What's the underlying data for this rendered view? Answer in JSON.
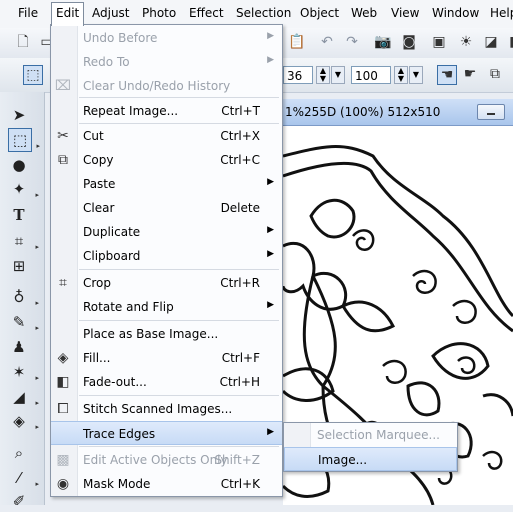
{
  "menubar": [
    "File",
    "Edit",
    "Adjust",
    "Photo",
    "Effect",
    "Selection",
    "Object",
    "Web",
    "View",
    "Window",
    "Help"
  ],
  "toolbar": {
    "field_a": "36",
    "field_b": "100"
  },
  "document": {
    "title": "1%255D (100%) 512x510"
  },
  "edit_menu": [
    {
      "label": "Undo Before",
      "shortcut": "",
      "submenu": true,
      "disabled": true,
      "icon": ""
    },
    {
      "label": "Redo To",
      "shortcut": "",
      "submenu": true,
      "disabled": true,
      "icon": ""
    },
    {
      "label": "Clear Undo/Redo History",
      "shortcut": "",
      "submenu": false,
      "disabled": true,
      "icon": "clear-history-icon"
    },
    {
      "label": "Repeat Image...",
      "shortcut": "Ctrl+T",
      "submenu": false,
      "disabled": false,
      "icon": ""
    },
    {
      "label": "Cut",
      "shortcut": "Ctrl+X",
      "submenu": false,
      "disabled": false,
      "icon": "scissors-icon"
    },
    {
      "label": "Copy",
      "shortcut": "Ctrl+C",
      "submenu": false,
      "disabled": false,
      "icon": "copy-icon"
    },
    {
      "label": "Paste",
      "shortcut": "",
      "submenu": true,
      "disabled": false,
      "icon": ""
    },
    {
      "label": "Clear",
      "shortcut": "Delete",
      "submenu": false,
      "disabled": false,
      "icon": ""
    },
    {
      "label": "Duplicate",
      "shortcut": "",
      "submenu": true,
      "disabled": false,
      "icon": ""
    },
    {
      "label": "Clipboard",
      "shortcut": "",
      "submenu": true,
      "disabled": false,
      "icon": ""
    },
    {
      "label": "Crop",
      "shortcut": "Ctrl+R",
      "submenu": false,
      "disabled": false,
      "icon": "crop-icon"
    },
    {
      "label": "Rotate and Flip",
      "shortcut": "",
      "submenu": true,
      "disabled": false,
      "icon": ""
    },
    {
      "label": "Place as Base Image...",
      "shortcut": "",
      "submenu": false,
      "disabled": false,
      "icon": ""
    },
    {
      "label": "Fill...",
      "shortcut": "Ctrl+F",
      "submenu": false,
      "disabled": false,
      "icon": "fill-bucket-icon"
    },
    {
      "label": "Fade-out...",
      "shortcut": "Ctrl+H",
      "submenu": false,
      "disabled": false,
      "icon": "fade-out-icon"
    },
    {
      "label": "Stitch Scanned Images...",
      "shortcut": "",
      "submenu": false,
      "disabled": false,
      "icon": "stitch-icon"
    },
    {
      "label": "Trace Edges",
      "shortcut": "",
      "submenu": true,
      "disabled": false,
      "icon": ""
    },
    {
      "label": "Edit Active Objects Only",
      "shortcut": "Shift+Z",
      "submenu": false,
      "disabled": true,
      "icon": "active-objects-icon"
    },
    {
      "label": "Mask Mode",
      "shortcut": "Ctrl+K",
      "submenu": false,
      "disabled": false,
      "icon": "mask-mode-icon"
    }
  ],
  "trace_edges_submenu": [
    {
      "label": "Selection Marquee...",
      "disabled": true
    },
    {
      "label": "Image...",
      "disabled": false
    }
  ]
}
